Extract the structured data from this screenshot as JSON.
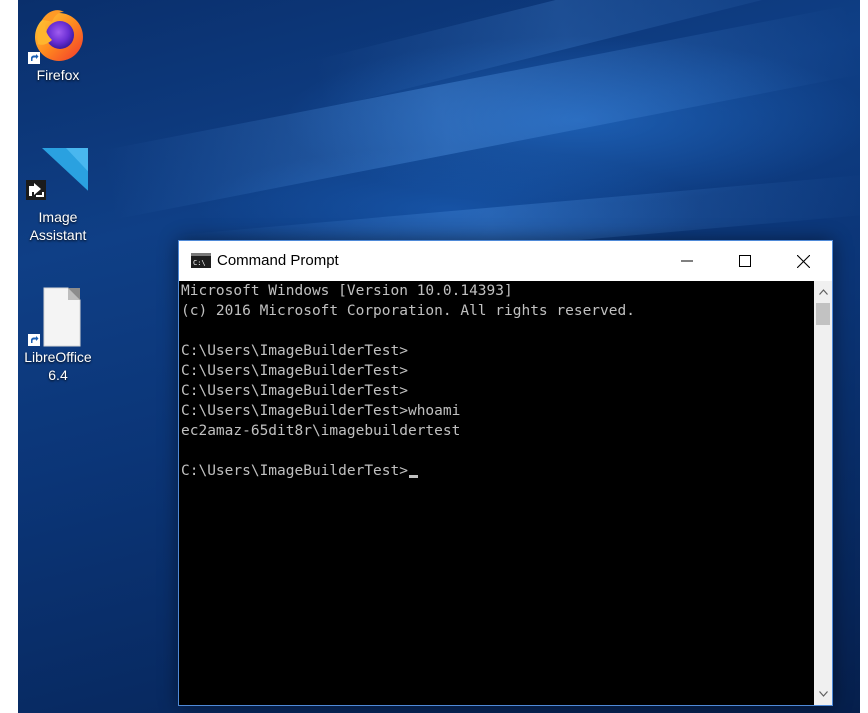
{
  "desktop": {
    "icons": [
      {
        "label": "Firefox",
        "icon": "firefox-icon"
      },
      {
        "label": "Image\nAssistant",
        "icon": "image-assistant-icon"
      },
      {
        "label": "LibreOffice\n6.4",
        "icon": "libreoffice-icon"
      }
    ]
  },
  "window": {
    "title": "Command Prompt",
    "icon": "cmd-icon",
    "controls": [
      "minimize-icon",
      "maximize-icon",
      "close-icon"
    ]
  },
  "console": {
    "lines": [
      "Microsoft Windows [Version 10.0.14393]",
      "(c) 2016 Microsoft Corporation. All rights reserved.",
      "",
      "C:\\Users\\ImageBuilderTest>",
      "C:\\Users\\ImageBuilderTest>",
      "C:\\Users\\ImageBuilderTest>",
      "C:\\Users\\ImageBuilderTest>whoami",
      "ec2amaz-65dit8r\\imagebuildertest",
      "",
      "C:\\Users\\ImageBuilderTest>"
    ]
  },
  "colors": {
    "desktop_background": "#0b3577",
    "console_background": "#000000",
    "console_text": "#c0c0c0",
    "window_border": "#4f8ad8"
  }
}
